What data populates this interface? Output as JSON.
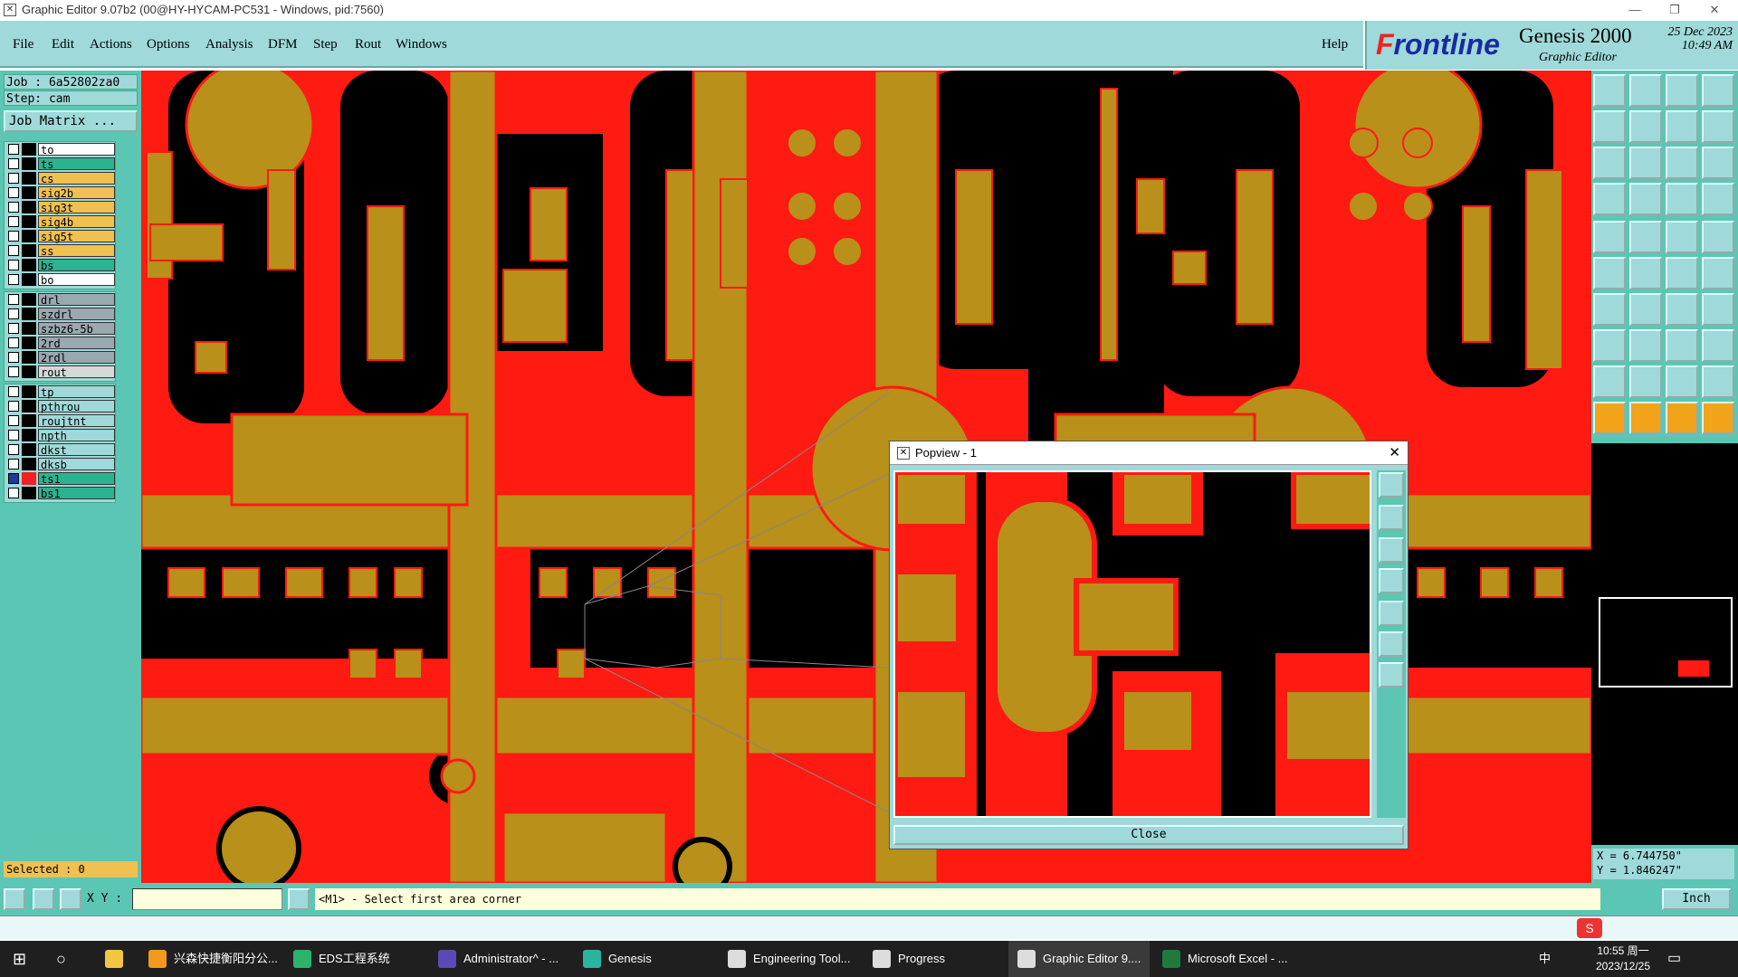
{
  "titlebar": {
    "title": "Graphic Editor 9.07b2 (00@HY-HYCAM-PC531 - Windows, pid:7560)"
  },
  "menu": [
    "File",
    "Edit",
    "Actions",
    "Options",
    "Analysis",
    "DFM",
    "Step",
    "Rout",
    "Windows"
  ],
  "help": "Help",
  "brand": {
    "logo": "Frontline",
    "product": "Genesis 2000",
    "subtitle": "Graphic Editor",
    "date": "25 Dec 2023",
    "time": "10:49 AM"
  },
  "job": {
    "job": "Job : 6a52802za0",
    "step": "Step: cam",
    "matrix": "Job Matrix ..."
  },
  "layers_group1": [
    {
      "name": "to",
      "color": "#ffffff"
    },
    {
      "name": "ts",
      "color": "#2bb38f"
    },
    {
      "name": "cs",
      "color": "#f0c050"
    },
    {
      "name": "sig2b",
      "color": "#f0c050"
    },
    {
      "name": "sig3t",
      "color": "#f0c050"
    },
    {
      "name": "sig4b",
      "color": "#f0c050"
    },
    {
      "name": "sig5t",
      "color": "#f0c050"
    },
    {
      "name": "ss",
      "color": "#f0c050"
    },
    {
      "name": "bs",
      "color": "#2bb38f"
    },
    {
      "name": "bo",
      "color": "#ffffff"
    }
  ],
  "layers_group2": [
    {
      "name": "drl",
      "color": "#9aa8b0"
    },
    {
      "name": "szdrl",
      "color": "#9aa8b0"
    },
    {
      "name": "szbz6-5b",
      "color": "#9aa8b0"
    },
    {
      "name": "2rd",
      "color": "#9aa8b0"
    },
    {
      "name": "2rdl",
      "color": "#9aa8b0"
    },
    {
      "name": "rout",
      "color": "#d8d8d8"
    }
  ],
  "layers_group3": [
    {
      "name": "tp",
      "color": "#9fd9d9"
    },
    {
      "name": "pthrou",
      "color": "#9fd9d9"
    },
    {
      "name": "roujtnt",
      "color": "#9fd9d9"
    },
    {
      "name": "npth",
      "color": "#9fd9d9"
    },
    {
      "name": "dkst",
      "color": "#9fd9d9"
    },
    {
      "name": "dksb",
      "color": "#9fd9d9"
    },
    {
      "name": "ts1",
      "color": "#2bb38f",
      "active": true
    },
    {
      "name": "bs1",
      "color": "#2bb38f"
    }
  ],
  "selected": "Selected : 0",
  "popview": {
    "title": "Popview - 1",
    "close": "Close"
  },
  "coords": {
    "x": "X = 6.744750\"",
    "y": "Y = 1.846247\""
  },
  "bottom": {
    "xy_label": "X Y :",
    "xy_value": "",
    "prompt": "<M1> - Select first area corner",
    "units": "Inch"
  },
  "taskbar": {
    "items": [
      "兴森快捷衡阳分公...",
      "EDS工程系统",
      "Administrator^ - ...",
      "Genesis",
      "Engineering Tool...",
      "Progress",
      "Graphic Editor 9....",
      "Microsoft Excel - ..."
    ],
    "clock_time": "10:55 周一",
    "clock_date": "2023/12/25",
    "ime": "中"
  },
  "colors": {
    "copper": "#b8901a",
    "background": "#ff1a12",
    "panel": "#5cc6b4",
    "menubar": "#9fd9d9"
  }
}
